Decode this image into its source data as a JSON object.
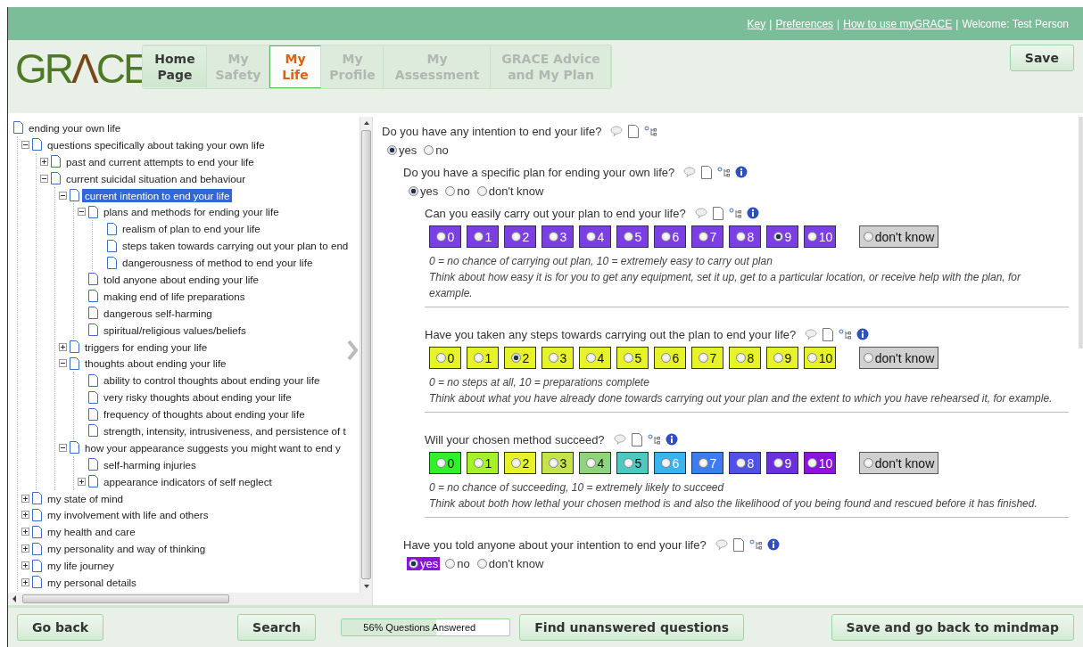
{
  "top_bar": {
    "links": [
      "Key",
      "Preferences",
      "How to use myGRACE"
    ],
    "separator": "|",
    "welcome": "Welcome: Test Person"
  },
  "logo": {
    "parts": [
      {
        "text": "GR",
        "color": "#4e7a26"
      },
      {
        "text": "Λ",
        "color": "#7a4818"
      },
      {
        "text": "CE",
        "color": "#4e7a26"
      }
    ]
  },
  "tabs": [
    {
      "label": "Home Page",
      "selected": false,
      "disabled": false
    },
    {
      "label": "My Safety",
      "selected": false,
      "disabled": true
    },
    {
      "label": "My Life",
      "selected": true,
      "disabled": false
    },
    {
      "label": "My Profile",
      "selected": false,
      "disabled": true
    },
    {
      "label": "My Assessment",
      "selected": false,
      "disabled": true
    },
    {
      "label": "GRACE Advice and My Plan",
      "selected": false,
      "disabled": true
    }
  ],
  "save_button": "Save",
  "tree": [
    {
      "label": "ending your own life",
      "selected": false,
      "children": [
        {
          "label": "questions specifically about taking your own life",
          "selected": false,
          "expanded": true,
          "children": [
            {
              "label": "past and current attempts to end your life",
              "selected": false,
              "expanded": false
            },
            {
              "label": "current suicidal situation and behaviour",
              "selected": false,
              "expanded": true,
              "children": [
                {
                  "label": "current intention to end your life",
                  "selected": true,
                  "expanded": true,
                  "children": [
                    {
                      "label": "plans and methods for ending your life",
                      "selected": false,
                      "expanded": true,
                      "children": [
                        {
                          "label": "realism of plan to end your life",
                          "selected": false
                        },
                        {
                          "label": "steps taken towards carrying out your plan to end",
                          "selected": false
                        },
                        {
                          "label": "dangerousness of method to end your life",
                          "selected": false
                        }
                      ]
                    },
                    {
                      "label": "told anyone about ending your life",
                      "selected": false
                    },
                    {
                      "label": "making end of life preparations",
                      "selected": false
                    },
                    {
                      "label": "dangerous self-harming",
                      "selected": false
                    },
                    {
                      "label": "spiritual/religious values/beliefs",
                      "selected": false
                    }
                  ]
                },
                {
                  "label": "triggers for ending your life",
                  "selected": false,
                  "expanded": false
                },
                {
                  "label": "thoughts about ending your life",
                  "selected": false,
                  "expanded": true,
                  "children": [
                    {
                      "label": "ability to control thoughts about ending your life",
                      "selected": false
                    },
                    {
                      "label": "very risky thoughts about ending your life",
                      "selected": false
                    },
                    {
                      "label": "frequency of thoughts about ending your life",
                      "selected": false
                    },
                    {
                      "label": "strength, intensity, intrusiveness, and persistence of t",
                      "selected": false
                    }
                  ]
                },
                {
                  "label": "how your appearance suggests you might want to end y",
                  "selected": false,
                  "expanded": true,
                  "children": [
                    {
                      "label": "self-harming injuries",
                      "selected": false
                    },
                    {
                      "label": "appearance indicators of self neglect",
                      "selected": false,
                      "expanded": false
                    }
                  ]
                }
              ]
            }
          ]
        },
        {
          "label": "my state of mind",
          "selected": false,
          "expanded": false
        },
        {
          "label": "my involvement with life and others",
          "selected": false,
          "expanded": false
        },
        {
          "label": "my health and care",
          "selected": false,
          "expanded": false
        },
        {
          "label": "my personality and way of thinking",
          "selected": false,
          "expanded": false
        },
        {
          "label": "my life journey",
          "selected": false,
          "expanded": false
        },
        {
          "label": "my personal details",
          "selected": false,
          "expanded": false
        }
      ]
    }
  ],
  "questions": [
    {
      "kind": "choice",
      "text": "Do you have any intention to end your life?",
      "info": false,
      "options": [
        {
          "label": "yes",
          "selected": true
        },
        {
          "label": "no",
          "selected": false
        }
      ],
      "children": [
        {
          "kind": "choice",
          "text": "Do you have a specific plan for ending your own life?",
          "info": true,
          "options": [
            {
              "label": "yes",
              "selected": true
            },
            {
              "label": "no",
              "selected": false
            },
            {
              "label": "don't know",
              "selected": false
            }
          ],
          "children": [
            {
              "kind": "scale",
              "text": "Can you easily carry out your plan to end your life?",
              "info": true,
              "options": [
                {
                  "label": "0",
                  "selected": false,
                  "color": "#7b3fe4"
                },
                {
                  "label": "1",
                  "selected": false,
                  "color": "#7b3fe4"
                },
                {
                  "label": "2",
                  "selected": false,
                  "color": "#7b3fe4"
                },
                {
                  "label": "3",
                  "selected": false,
                  "color": "#7b3fe4"
                },
                {
                  "label": "4",
                  "selected": false,
                  "color": "#7b3fe4"
                },
                {
                  "label": "5",
                  "selected": false,
                  "color": "#7b3fe4"
                },
                {
                  "label": "6",
                  "selected": false,
                  "color": "#7b3fe4"
                },
                {
                  "label": "7",
                  "selected": false,
                  "color": "#7b3fe4"
                },
                {
                  "label": "8",
                  "selected": false,
                  "color": "#7b3fe4"
                },
                {
                  "label": "9",
                  "selected": true,
                  "color": "#7b3fe4"
                },
                {
                  "label": "10",
                  "selected": false,
                  "color": "#7b3fe4"
                }
              ],
              "dont_know": {
                "label": "don't know",
                "selected": false
              },
              "scale_hint": "0 = no chance of carrying out plan, 10 = extremely easy to carry out plan",
              "guidance": "Think about how easy it is for you to get any equipment, set it up, get to a particular location, or receive help with the plan, for example."
            },
            {
              "kind": "scale",
              "text": "Have you taken any steps towards carrying out the plan to end your life?",
              "info": true,
              "options": [
                {
                  "label": "0",
                  "selected": false,
                  "color": "#e6f22a"
                },
                {
                  "label": "1",
                  "selected": false,
                  "color": "#e6f22a"
                },
                {
                  "label": "2",
                  "selected": true,
                  "color": "#e6f22a"
                },
                {
                  "label": "3",
                  "selected": false,
                  "color": "#e6f22a"
                },
                {
                  "label": "4",
                  "selected": false,
                  "color": "#e6f22a"
                },
                {
                  "label": "5",
                  "selected": false,
                  "color": "#e6f22a"
                },
                {
                  "label": "6",
                  "selected": false,
                  "color": "#e6f22a"
                },
                {
                  "label": "7",
                  "selected": false,
                  "color": "#e6f22a"
                },
                {
                  "label": "8",
                  "selected": false,
                  "color": "#e6f22a"
                },
                {
                  "label": "9",
                  "selected": false,
                  "color": "#e6f22a"
                },
                {
                  "label": "10",
                  "selected": false,
                  "color": "#e6f22a"
                }
              ],
              "dont_know": {
                "label": "don't know",
                "selected": false
              },
              "scale_hint": "0 = no steps at all, 10 = preparations complete",
              "guidance": "Think about what you have already done towards carrying out your plan and the extent to which you have rehearsed it, for example."
            },
            {
              "kind": "scale",
              "text": "Will your chosen method succeed?",
              "info": true,
              "options": [
                {
                  "label": "0",
                  "selected": false,
                  "color": "#2ef22a"
                },
                {
                  "label": "1",
                  "selected": false,
                  "color": "#a4f22a"
                },
                {
                  "label": "2",
                  "selected": false,
                  "color": "#e6f22a"
                },
                {
                  "label": "3",
                  "selected": false,
                  "color": "#c4e44a"
                },
                {
                  "label": "4",
                  "selected": false,
                  "color": "#8ed47a"
                },
                {
                  "label": "5",
                  "selected": false,
                  "color": "#4fc9bf"
                },
                {
                  "label": "6",
                  "selected": false,
                  "color": "#3ab4ec"
                },
                {
                  "label": "7",
                  "selected": false,
                  "color": "#3f7cf0"
                },
                {
                  "label": "8",
                  "selected": false,
                  "color": "#5050e8"
                },
                {
                  "label": "9",
                  "selected": false,
                  "color": "#6a30e0"
                },
                {
                  "label": "10",
                  "selected": false,
                  "color": "#8a14de"
                }
              ],
              "dont_know": {
                "label": "don't know",
                "selected": false
              },
              "scale_hint": "0 = no chance of succeeding, 10 = extremely likely to succeed",
              "guidance": "Think about both how lethal your chosen method is and also the likelihood of you being found and rescued before it has finished."
            }
          ]
        },
        {
          "kind": "choice",
          "text": "Have you told anyone about your intention to end your life?",
          "info": true,
          "options": [
            {
              "label": "yes",
              "selected": true,
              "color": "#8a14de"
            },
            {
              "label": "no",
              "selected": false
            },
            {
              "label": "don't know",
              "selected": false
            }
          ]
        }
      ]
    }
  ],
  "footer": {
    "back_button": "Go back",
    "search_button": "Search",
    "progress": {
      "label": "56% Questions Answered",
      "level": 0.56
    },
    "find_button": "Find unanswered questions",
    "save_back_button": "Save and go back to mindmap"
  }
}
